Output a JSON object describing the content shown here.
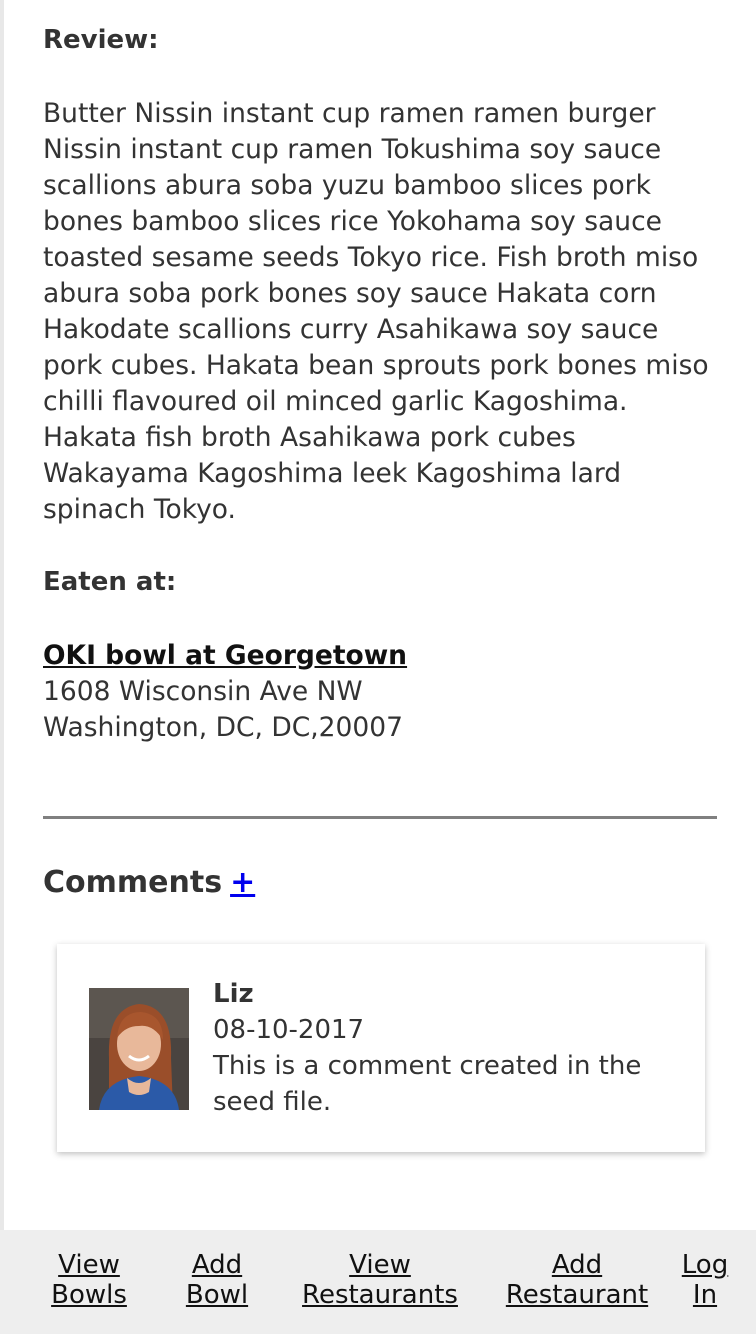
{
  "review": {
    "heading": "Review:",
    "text": "Butter Nissin instant cup ramen ramen burger Nissin instant cup ramen Tokushima soy sauce scallions abura soba yuzu bamboo slices pork bones bamboo slices rice Yokohama soy sauce toasted sesame seeds Tokyo rice. Fish broth miso abura soba pork bones soy sauce Hakata corn Hakodate scallions curry Asahikawa soy sauce pork cubes. Hakata bean sprouts pork bones miso chilli flavoured oil minced garlic Kagoshima. Hakata fish broth Asahikawa pork cubes Wakayama Kagoshima leek Kagoshima lard spinach Tokyo."
  },
  "eaten_at": {
    "heading": "Eaten at:",
    "restaurant_name": "OKI bowl at Georgetown",
    "address_line1": "1608 Wisconsin Ave NW",
    "address_line2": "Washington, DC, DC,20007"
  },
  "comments": {
    "heading": "Comments",
    "add_label": "+",
    "items": [
      {
        "author": "Liz",
        "date": "08-10-2017",
        "body": "This is a comment created in the seed file."
      }
    ]
  },
  "nav": {
    "view_bowls": [
      "View",
      "Bowls"
    ],
    "add_bowl": [
      "Add",
      "Bowl"
    ],
    "view_restaurants": [
      "View",
      "Restaurants"
    ],
    "add_restaurant": [
      "Add",
      "Restaurant"
    ],
    "log_in": [
      "Log",
      "In"
    ]
  },
  "colors": {
    "link": "#0000ee",
    "text": "#333333",
    "divider": "#808080",
    "nav_bg": "#eeeeee"
  }
}
